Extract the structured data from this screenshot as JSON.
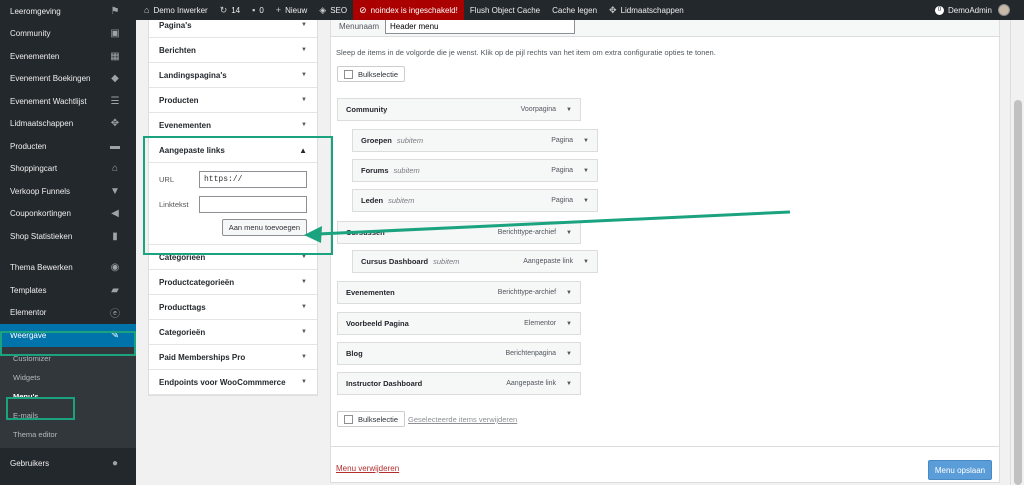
{
  "adminbar": {
    "site_name": "Demo Inwerker",
    "updates": "14",
    "comments": "0",
    "new": "Nieuw",
    "seo": "SEO",
    "noindex": "noindex is ingeschakeld!",
    "flush": "Flush Object Cache",
    "cache": "Cache legen",
    "memberships": "Lidmaatschappen",
    "user": "DemoAdmin"
  },
  "sidebar": {
    "items": [
      {
        "label": "Leeromgeving",
        "icon": "graduation-cap-icon"
      },
      {
        "label": "Community",
        "icon": "id-card-icon"
      },
      {
        "label": "Evenementen",
        "icon": "calendar-icon"
      },
      {
        "label": "Evenement Boekingen",
        "icon": "tag-icon"
      },
      {
        "label": "Evenement Wachtlijst",
        "icon": "list-icon"
      },
      {
        "label": "Lidmaatschappen",
        "icon": "groups-icon"
      },
      {
        "label": "Producten",
        "icon": "archive-icon"
      },
      {
        "label": "Shoppingcart",
        "icon": "store-icon"
      },
      {
        "label": "Verkoop Funnels",
        "icon": "funnel-icon"
      },
      {
        "label": "Couponkortingen",
        "icon": "megaphone-icon"
      },
      {
        "label": "Shop Statistieken",
        "icon": "bar-chart-icon"
      }
    ],
    "items2": [
      {
        "label": "Thema Bewerken",
        "icon": "eye-icon"
      },
      {
        "label": "Templates",
        "icon": "folder-icon"
      },
      {
        "label": "Elementor",
        "icon": "elementor-icon"
      }
    ],
    "current": {
      "label": "Weergave",
      "icon": "paintbrush-icon"
    },
    "submenu": [
      "Customizer",
      "Widgets",
      "Menu's",
      "E-mails",
      "Thema editor"
    ],
    "users": "Gebruikers"
  },
  "accordion": {
    "top_rows": [
      "Pagina's",
      "Berichten",
      "Landingspagina's",
      "Producten",
      "Evenementen"
    ],
    "open": {
      "title": "Aangepaste links",
      "url_label": "URL",
      "url_value": "https://",
      "link_label": "Linktekst",
      "link_value": "",
      "add_button": "Aan menu toevoegen"
    },
    "bottom_rows": [
      "Categorieën",
      "Productcategorieën",
      "Producttags",
      "Categorieën",
      "Paid Memberships Pro",
      "Endpoints voor WooCommmerce"
    ]
  },
  "menu": {
    "name_label": "Menunaam",
    "name_value": "Header menu",
    "instructions": "Sleep de items in de volgorde die je wenst. Klik op de pijl rechts van het item om extra configuratie opties te tonen.",
    "bulk_label": "Bulkselectie",
    "items": [
      {
        "title": "Community",
        "sub": "",
        "type": "Voorpagina"
      },
      {
        "title": "Groepen",
        "sub": "subitem",
        "type": "Pagina"
      },
      {
        "title": "Forums",
        "sub": "subitem",
        "type": "Pagina"
      },
      {
        "title": "Leden",
        "sub": "subitem",
        "type": "Pagina"
      },
      {
        "title": "Cursussen",
        "sub": "",
        "type": "Berichttype-archief"
      },
      {
        "title": "Cursus Dashboard",
        "sub": "subitem",
        "type": "Aangepaste link"
      },
      {
        "title": "Evenementen",
        "sub": "",
        "type": "Berichttype-archief"
      },
      {
        "title": "Voorbeeld Pagina",
        "sub": "",
        "type": "Elementor"
      },
      {
        "title": "Blog",
        "sub": "",
        "type": "Berichtenpagina"
      },
      {
        "title": "Instructor Dashboard",
        "sub": "",
        "type": "Aangepaste link"
      }
    ],
    "delete_selected": "Geselecteerde items verwijderen",
    "delete_menu": "Menu verwijderen",
    "save": "Menu opslaan"
  },
  "colors": {
    "highlight": "#1ba37f",
    "admin_bg": "#23282d",
    "accent": "#0073aa"
  }
}
